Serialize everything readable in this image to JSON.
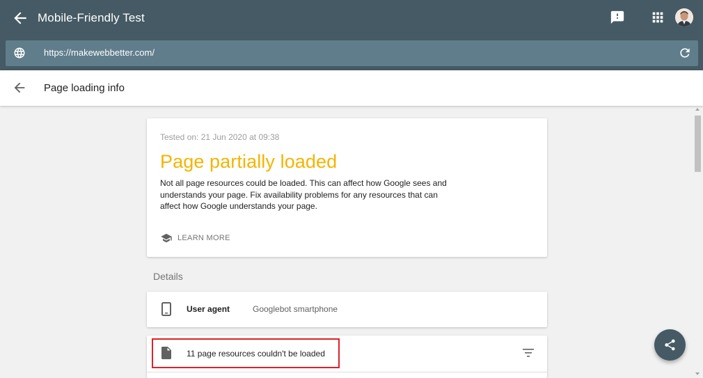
{
  "app": {
    "title": "Mobile-Friendly Test",
    "url": "https://makewebbetter.com/"
  },
  "subheader": {
    "title": "Page loading info"
  },
  "status": {
    "tested": "Tested on: 21 Jun 2020 at 09:38",
    "heading": "Page partially loaded",
    "heading_color": "#f4b400",
    "description": "Not all page resources could be loaded. This can affect how Google sees and understands your page. Fix availability problems for any resources that can affect how Google understands your page.",
    "learn_more": "LEARN MORE"
  },
  "details": {
    "label": "Details",
    "user_agent_key": "User agent",
    "user_agent_value": "Googlebot smartphone",
    "resources_text": "11 page resources couldn't be loaded"
  },
  "colors": {
    "app_bar": "#455a64",
    "url_bar": "#607d8b",
    "highlight": "#e0202a"
  },
  "icons": [
    "back-arrow-icon",
    "feedback-icon",
    "apps-grid-icon",
    "globe-icon",
    "refresh-icon",
    "graduation-cap-icon",
    "smartphone-icon",
    "document-icon",
    "filter-icon",
    "share-icon"
  ]
}
